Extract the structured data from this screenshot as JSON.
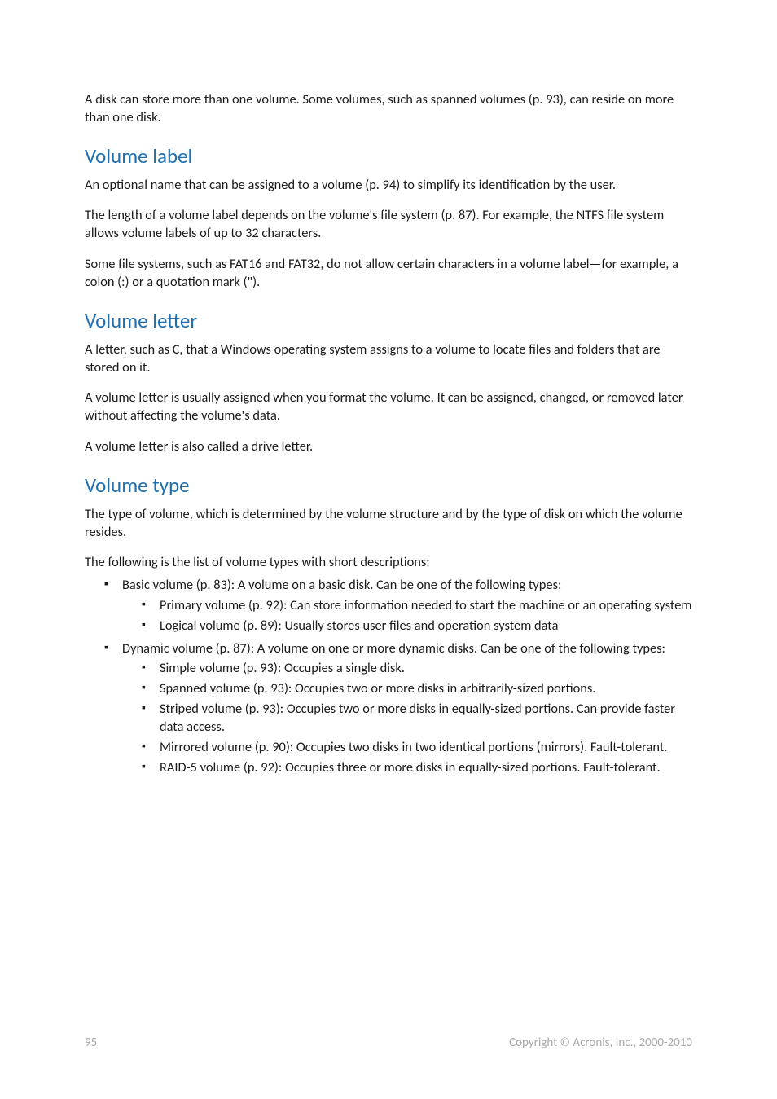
{
  "intro": "A disk can store more than one volume. Some volumes, such as spanned volumes (p. 93), can reside on more than one disk.",
  "sections": {
    "volume_label": {
      "heading": "Volume label",
      "p1": "An optional name that can be assigned to a volume (p. 94) to simplify its identification by the user.",
      "p2": "The length of a volume label depends on the volume's file system (p. 87). For example, the NTFS file system allows volume labels of up to 32 characters.",
      "p3": "Some file systems, such as FAT16 and FAT32, do not allow certain characters in a volume label—for example, a colon (:) or a quotation mark (\")."
    },
    "volume_letter": {
      "heading": "Volume letter",
      "p1": "A letter, such as C, that a Windows operating system assigns to a volume to locate files and folders that are stored on it.",
      "p2": "A volume letter is usually assigned when you format the volume. It can be assigned, changed, or removed later without affecting the volume's data.",
      "p3": "A volume letter is also called a drive letter."
    },
    "volume_type": {
      "heading": "Volume type",
      "p1": "The type of volume, which is determined by the volume structure and by the type of disk on which the volume resides.",
      "p2": "The following is the list of volume types with short descriptions:",
      "bullets": {
        "b1": "Basic volume (p. 83): A volume on a basic disk. Can be one of the following types:",
        "b1_sub": {
          "s1": "Primary volume (p. 92): Can store information needed to start the machine or an operating system",
          "s2": "Logical volume (p. 89): Usually stores user files and operation system data"
        },
        "b2": "Dynamic volume (p. 87): A volume on one or more dynamic disks. Can be one of the following types:",
        "b2_sub": {
          "s1": "Simple volume (p. 93): Occupies a single disk.",
          "s2": "Spanned volume (p. 93): Occupies two or more disks in arbitrarily-sized portions.",
          "s3": "Striped volume (p. 93): Occupies two or more disks in equally-sized portions. Can provide faster data access.",
          "s4": "Mirrored volume (p. 90): Occupies two disks in two identical portions (mirrors). Fault-tolerant.",
          "s5": "RAID-5 volume (p. 92): Occupies three or more disks in equally-sized portions. Fault-tolerant."
        }
      }
    }
  },
  "footer": {
    "page_number": "95",
    "copyright": "Copyright © Acronis, Inc., 2000-2010"
  }
}
